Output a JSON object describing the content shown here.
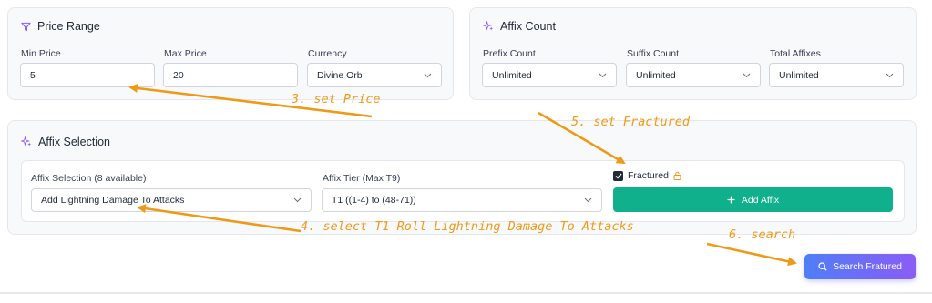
{
  "price_range": {
    "title": "Price Range",
    "min_label": "Min Price",
    "min_value": "5",
    "max_label": "Max Price",
    "max_value": "20",
    "currency_label": "Currency",
    "currency_value": "Divine Orb"
  },
  "affix_count": {
    "title": "Affix Count",
    "prefix_label": "Prefix Count",
    "prefix_value": "Unlimited",
    "suffix_label": "Suffix Count",
    "suffix_value": "Unlimited",
    "total_label": "Total Affixes",
    "total_value": "Unlimited"
  },
  "affix_selection": {
    "title": "Affix Selection",
    "selection_label": "Affix Selection (8 available)",
    "selection_value": "Add Lightning Damage To Attacks",
    "tier_label": "Affix Tier (Max T9)",
    "tier_value": "T1 ((1-4) to (48-71))",
    "fractured_label": "Fractured",
    "fractured_checked": true,
    "add_button": "Add Affix"
  },
  "search_button": "Search Fratured",
  "annotations": {
    "step3": "3. set Price",
    "step4": "4. select T1 Roll Lightning Damage To Attacks",
    "step5": "5. set Fractured",
    "step6": "6. search"
  },
  "colors": {
    "accent_purple": "#8b5cf6",
    "add_button_green": "#10b08c",
    "annotation_orange": "#ef9a17",
    "search_gradient_start": "#4f7ef7",
    "search_gradient_end": "#8b5cf6"
  },
  "icons": {
    "price_range": "filter-icon",
    "affix_count": "sparkles-icon",
    "affix_selection": "sparkles-icon",
    "add": "plus-icon",
    "search": "search-icon",
    "fractured": "lock-icon"
  }
}
